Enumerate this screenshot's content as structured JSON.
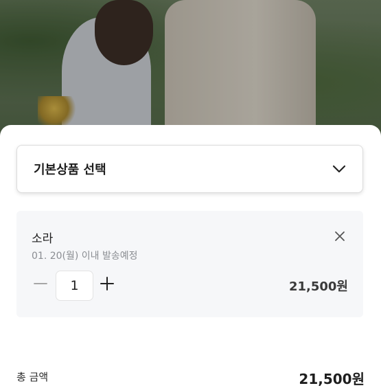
{
  "option_select": {
    "label": "기본상품 선택",
    "icon": "chevron-down-icon"
  },
  "selected_item": {
    "name": "소라",
    "shipping_note": "01. 20(월) 이내 발송예정",
    "quantity": "1",
    "price": "21,500원",
    "remove_icon": "close-icon",
    "decrease_icon": "minus-icon",
    "increase_icon": "plus-icon"
  },
  "total": {
    "label": "총 금액",
    "value": "21,500원"
  }
}
